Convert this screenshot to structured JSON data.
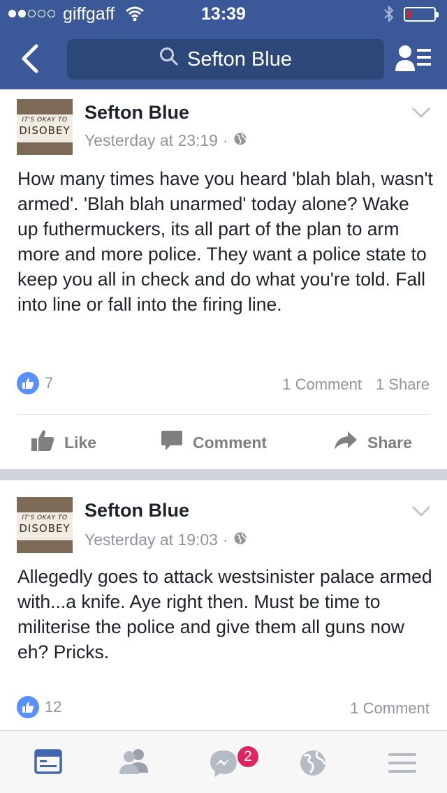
{
  "status_bar": {
    "carrier": "giffgaff",
    "time": "13:39",
    "battery_level": 0.12,
    "signal_bars_filled": 2,
    "signal_bars_total": 5
  },
  "nav": {
    "search_text": "Sefton Blue",
    "icons": [
      "back-chevron-icon",
      "search-icon",
      "friends-list-icon"
    ]
  },
  "posts": [
    {
      "author": "Sefton Blue",
      "avatar_text": [
        "IT'S OKAY TO",
        "DISOBEY"
      ],
      "timestamp": "Yesterday at 23:19",
      "separator": "·",
      "privacy_icon": "globe-icon",
      "text": "How many times have you heard 'blah blah, wasn't armed'. 'Blah blah unarmed' today alone? Wake up futhermuckers, its all part of the plan to arm more and more police. They want a police state to keep you all in check and do what you're told. Fall into line or fall into the firing line.",
      "likes": "7",
      "comments": "1 Comment",
      "shares": "1 Share",
      "actions": {
        "like": "Like",
        "comment": "Comment",
        "share": "Share"
      }
    },
    {
      "author": "Sefton Blue",
      "avatar_text": [
        "IT'S OKAY TO",
        "DISOBEY"
      ],
      "timestamp": "Yesterday at 19:03",
      "separator": "·",
      "privacy_icon": "globe-icon",
      "text": "Allegedly goes to attack westsinister palace armed with...a knife. Aye right then.  Must be time to militerise the police and give them all guns now eh?  Pricks.",
      "likes": "12",
      "comments": "1 Comment"
    }
  ],
  "tab_bar": {
    "tabs": [
      "news-feed-icon",
      "friend-requests-icon",
      "messenger-icon",
      "notifications-globe-icon",
      "menu-icon"
    ],
    "messenger_badge": "2",
    "accent": "#4267b2"
  },
  "colors": {
    "brand": "#3b5998",
    "search_bg": "#2d4778",
    "like_blue": "#5890ff",
    "badge_red": "#e0245e"
  }
}
